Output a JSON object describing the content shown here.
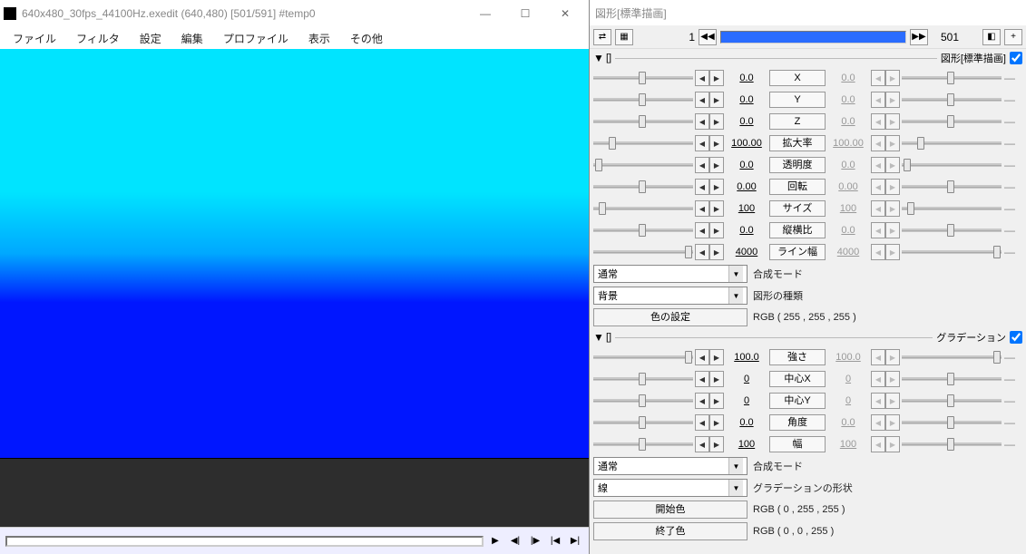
{
  "window": {
    "title": "640x480_30fps_44100Hz.exedit (640,480)  [501/591]  #temp0",
    "minimize": "—",
    "maximize": "☐",
    "close": "✕"
  },
  "menu": [
    "ファイル",
    "フィルタ",
    "設定",
    "編集",
    "プロファイル",
    "表示",
    "その他"
  ],
  "timeline_frame": "1",
  "total_frames": "501",
  "right_title": "図形[標準描画]",
  "section1": {
    "bracket": "[]",
    "title": "図形[標準描画]",
    "params": [
      {
        "label": "X",
        "l": "0.0",
        "r": "0.0",
        "grey": true,
        "lp": 45,
        "rp": 45
      },
      {
        "label": "Y",
        "l": "0.0",
        "r": "0.0",
        "grey": true,
        "lp": 45,
        "rp": 45
      },
      {
        "label": "Z",
        "l": "0.0",
        "r": "0.0",
        "grey": true,
        "lp": 45,
        "rp": 45
      },
      {
        "label": "拡大率",
        "l": "100.00",
        "r": "100.00",
        "grey": true,
        "lp": 15,
        "rp": 15
      },
      {
        "label": "透明度",
        "l": "0.0",
        "r": "0.0",
        "grey": true,
        "lp": 2,
        "rp": 2
      },
      {
        "label": "回転",
        "l": "0.00",
        "r": "0.00",
        "grey": true,
        "lp": 45,
        "rp": 45
      },
      {
        "label": "サイズ",
        "l": "100",
        "r": "100",
        "grey": true,
        "lp": 5,
        "rp": 5
      },
      {
        "label": "縦横比",
        "l": "0.0",
        "r": "0.0",
        "grey": true,
        "lp": 45,
        "rp": 45
      },
      {
        "label": "ライン幅",
        "l": "4000",
        "r": "4000",
        "grey": true,
        "lp": 92,
        "rp": 92
      }
    ],
    "blend_label": "合成モード",
    "blend_value": "通常",
    "shape_label": "図形の種類",
    "shape_value": "背景",
    "color_btn": "色の設定",
    "color_value": "RGB ( 255 , 255 , 255 )"
  },
  "section2": {
    "bracket": "[]",
    "title": "グラデーション",
    "params": [
      {
        "label": "強さ",
        "l": "100.0",
        "r": "100.0",
        "grey": true,
        "lp": 92,
        "rp": 92
      },
      {
        "label": "中心X",
        "l": "0",
        "r": "0",
        "grey": true,
        "lp": 45,
        "rp": 45
      },
      {
        "label": "中心Y",
        "l": "0",
        "r": "0",
        "grey": true,
        "lp": 45,
        "rp": 45
      },
      {
        "label": "角度",
        "l": "0.0",
        "r": "0.0",
        "grey": true,
        "lp": 45,
        "rp": 45
      },
      {
        "label": "幅",
        "l": "100",
        "r": "100",
        "grey": true,
        "lp": 45,
        "rp": 45
      }
    ],
    "blend_label": "合成モード",
    "blend_value": "通常",
    "grad_shape_label": "グラデーションの形状",
    "grad_shape_value": "線",
    "start_color_btn": "開始色",
    "start_color_value": "RGB ( 0 , 255 , 255 )",
    "end_color_btn": "終了色",
    "end_color_value": "RGB ( 0 , 0 , 255 )"
  }
}
